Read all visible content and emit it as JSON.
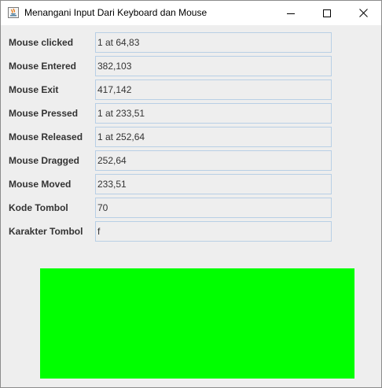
{
  "window": {
    "title": "Menangani Input Dari Keyboard dan Mouse"
  },
  "fields": [
    {
      "label": "Mouse clicked",
      "value": "1 at 64,83"
    },
    {
      "label": "Mouse Entered",
      "value": "382,103"
    },
    {
      "label": "Mouse Exit",
      "value": "417,142"
    },
    {
      "label": "Mouse Pressed",
      "value": "1 at 233,51"
    },
    {
      "label": "Mouse Released",
      "value": "1 at 252,64"
    },
    {
      "label": "Mouse Dragged",
      "value": "252,64"
    },
    {
      "label": "Mouse Moved",
      "value": "233,51"
    },
    {
      "label": "Kode Tombol",
      "value": "70"
    },
    {
      "label": "Karakter Tombol",
      "value": "f"
    }
  ],
  "panel": {
    "color": "#00ff00"
  },
  "icons": {
    "app": "java-app-icon",
    "minimize": "minimize-icon",
    "maximize": "maximize-icon",
    "close": "close-icon"
  }
}
